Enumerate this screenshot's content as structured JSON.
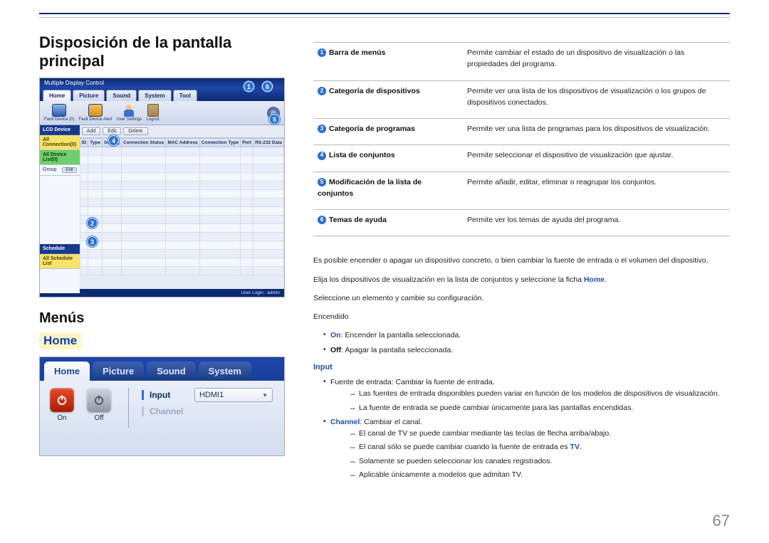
{
  "headings": {
    "h1": "Disposición de la pantalla principal",
    "menus": "Menús",
    "home": "Home"
  },
  "pagenum": "67",
  "app": {
    "title": "Multiple Display Control",
    "tabs": [
      "Home",
      "Picture",
      "Sound",
      "System",
      "Tool"
    ],
    "tb_icons": {
      "fault": "Fault Device\n(0)",
      "alert": "Fault Device\nAlert",
      "user": "User Settings",
      "logout": "Logout"
    },
    "side": {
      "lcd": "LCD Device",
      "all_conn": "All Connection(0)",
      "all_list": "All Device List(0)",
      "group": "Group",
      "edit": "Edit",
      "schedule": "Schedule",
      "all_sched": "All Schedule List"
    },
    "dev_header_cols": [
      "ID",
      "Type",
      "Setting",
      "Connection Status",
      "MAC Address",
      "Connection Type",
      "Port",
      "RS-232 Data"
    ],
    "dev_btns": [
      "Add",
      "Edit",
      "Delete"
    ],
    "status": "User Login : admin"
  },
  "legend": [
    {
      "n": "1",
      "label": "Barra de menús",
      "desc": "Permite cambiar el estado de un dispositivo de visualización o las propiedades del programa."
    },
    {
      "n": "2",
      "label": "Categoría de dispositivos",
      "desc": "Permite ver una lista de los dispositivos de visualización o los grupos de dispositivos conectados."
    },
    {
      "n": "3",
      "label": "Categoría de programas",
      "desc": "Permite ver una lista de programas para los dispositivos de visualización."
    },
    {
      "n": "4",
      "label": "Lista de conjuntos",
      "desc": "Permite seleccionar el dispositivo de visualización que ajustar."
    },
    {
      "n": "5",
      "label": "Modificación de la lista de conjuntos",
      "desc": "Permite añadir, editar, eliminar o reagrupar los conjuntos."
    },
    {
      "n": "6",
      "label": "Temas de ayuda",
      "desc": "Permite ver los temas de ayuda del programa."
    }
  ],
  "zoom": {
    "tabs": [
      "Home",
      "Picture",
      "Sound",
      "System"
    ],
    "on": "On",
    "off": "Off",
    "input_label": "Input",
    "input_value": "HDMI1",
    "channel_label": "Channel"
  },
  "txt": {
    "p1a": "Es posible encender o apagar un dispositivo concreto, o bien cambiar la fuente de entrada o el volumen del dispositivo.",
    "p2a": "Elija los dispositivos de visualización en la lista de conjuntos y seleccione la ficha ",
    "p2b": "Home",
    "p2c": ".",
    "p3": "Seleccione un elemento y cambie su configuración.",
    "enc": "Encendido",
    "b1a": "On",
    "b1b": ": Encender la pantalla seleccionada.",
    "b2a": "Off",
    "b2b": ": Apagar la pantalla seleccionada.",
    "input": "Input",
    "in1": "Fuente de entrada: Cambiar la fuente de entrada.",
    "in1a": "Las fuentes de entrada disponibles pueden variar en función de los modelos de dispositivos de visualización.",
    "in1b": "La fuente de entrada se puede cambiar únicamente para las pantallas encendidas.",
    "ch1a": "Channel",
    "ch1b": ": Cambiar el canal.",
    "ch_d1": "El canal de TV se puede cambiar mediante las teclas de flecha arriba/abajo.",
    "ch_d2a": "El canal sólo se puede cambiar cuando la fuente de entrada es ",
    "ch_d2b": "TV",
    "ch_d2c": ".",
    "ch_d3": "Solamente se pueden seleccionar los canales registrados.",
    "ch_d4": "Aplicable únicamente a modelos que admitan TV."
  }
}
